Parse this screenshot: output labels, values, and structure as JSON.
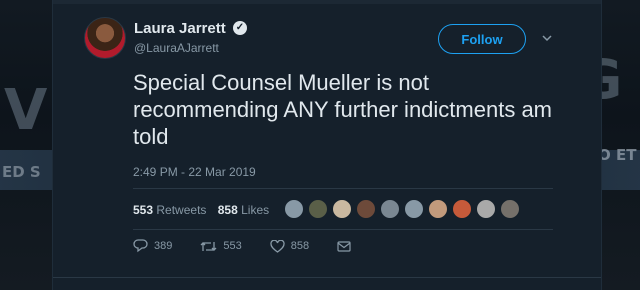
{
  "author": {
    "name": "Laura Jarrett",
    "handle": "@LauraAJarrett",
    "verified": true
  },
  "follow_label": "Follow",
  "tweet": {
    "text": "Special Counsel Mueller is not recommending ANY further indictments am told",
    "timestamp": "2:49 PM - 22 Mar 2019"
  },
  "stats": {
    "retweets_count": "553",
    "retweets_label": "Retweets",
    "likes_count": "858",
    "likes_label": "Likes"
  },
  "likers": [
    {
      "color": "#8899a6"
    },
    {
      "color": "#5a5f48"
    },
    {
      "color": "#c9b8a0"
    },
    {
      "color": "#6d4a3a"
    },
    {
      "color": "#7a8792"
    },
    {
      "color": "#8899a6"
    },
    {
      "color": "#c29a7c"
    },
    {
      "color": "#c65a3a"
    },
    {
      "color": "#a9a9a9"
    },
    {
      "color": "#75706a"
    }
  ],
  "actions": {
    "reply_count": "389",
    "retweet_count": "553",
    "like_count": "858"
  },
  "colors": {
    "accent": "#1da1f2",
    "card_bg": "#15202b",
    "text": "#e1e8ed",
    "muted": "#8899a6"
  },
  "icons": {
    "verified": "verified-badge-icon",
    "menu": "chevron-down-icon",
    "reply": "reply-icon",
    "retweet": "retweet-icon",
    "like": "heart-icon",
    "dm": "envelope-icon"
  }
}
